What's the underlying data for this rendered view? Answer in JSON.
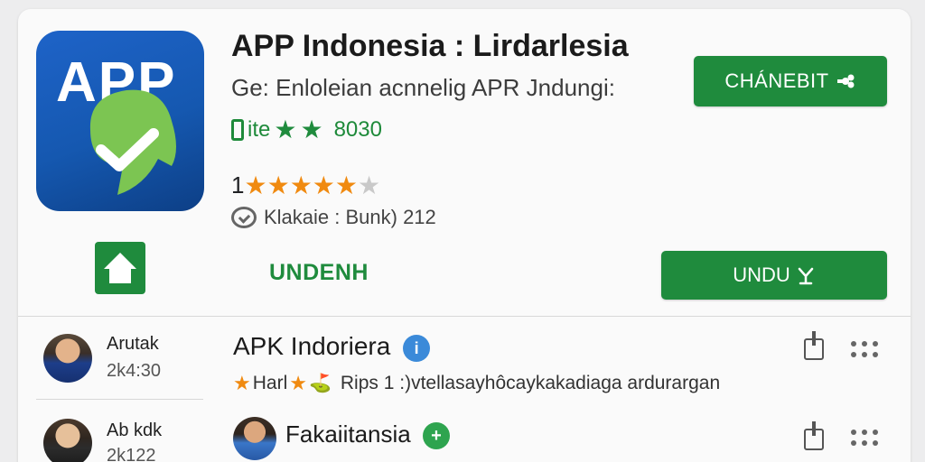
{
  "app": {
    "icon_text": "APP",
    "title": "APP Indonesia : Lirdarlesia",
    "subtitle": "Ge: Enloleian acnnelig APR Jndungi:",
    "store_label": "ite",
    "store_count": "8030",
    "rating_prefix": "1",
    "rating_stars": 5.5,
    "meta_text": "Klakaie : Bunk) 212",
    "primary_button": "CHÁNEBIT",
    "text_button": "UNDENH",
    "install_button": "UNDU"
  },
  "list": [
    {
      "author": "Arutak",
      "time": "2k4:30",
      "title": "APK Indoriera",
      "badge": "i",
      "sub_prefix": "Harl",
      "sub_text": "Rips  1 :)vtellasayhôcaykakadiaga ardurargan"
    },
    {
      "author": "Ab kdk",
      "time": "2k122",
      "title": "Fakaiitansia",
      "badge": "+",
      "sub_prefix": "",
      "sub_text": ""
    }
  ],
  "colors": {
    "brand_green": "#1f8b3d",
    "star_orange": "#f08a10",
    "icon_blue": "#1e63c8",
    "check_green": "#7cc552"
  },
  "icons": [
    "phone-icon",
    "star-icon",
    "chat-icon",
    "home-icon",
    "share-icon",
    "more-icon",
    "check-badge-icon"
  ]
}
